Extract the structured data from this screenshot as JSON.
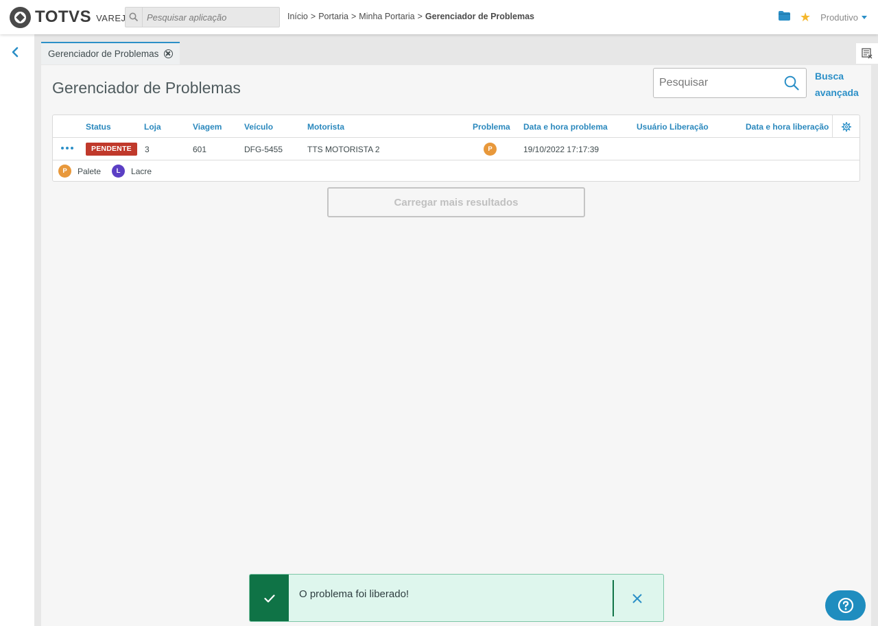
{
  "brand": {
    "name": "TOTVS",
    "product": "VAREJO"
  },
  "app_search": {
    "placeholder": "Pesquisar aplicação"
  },
  "breadcrumb": {
    "items": [
      "Início",
      "Portaria",
      "Minha Portaria"
    ],
    "current": "Gerenciador de Problemas",
    "separator": ">"
  },
  "header": {
    "user_menu": "Produtivo"
  },
  "tabs": [
    {
      "label": "Gerenciador de Problemas"
    }
  ],
  "page": {
    "title": "Gerenciador de Problemas",
    "search_placeholder": "Pesquisar",
    "advanced_search": "Busca avançada"
  },
  "table": {
    "columns": [
      "Status",
      "Loja",
      "Viagem",
      "Veículo",
      "Motorista",
      "Problema",
      "Data e hora problema",
      "Usuário Liberação",
      "Data e hora liberação"
    ],
    "rows": [
      {
        "status": "PENDENTE",
        "loja": "3",
        "viagem": "601",
        "veiculo": "DFG-5455",
        "motorista": "TTS MOTORISTA 2",
        "problema": "P",
        "data_hora_problema": "19/10/2022 17:17:39",
        "usuario_liberacao": "",
        "data_hora_liberacao": ""
      }
    ],
    "legend": [
      {
        "letter": "P",
        "label": "Palete",
        "color": "#e8983b"
      },
      {
        "letter": "L",
        "label": "Lacre",
        "color": "#5b3fc4"
      }
    ],
    "load_more": "Carregar mais resultados"
  },
  "toast": {
    "message": "O problema foi liberado!",
    "type": "success"
  },
  "colors": {
    "accent": "#2b8fc7",
    "status_pending": "#c0392b",
    "success": "#0f7346"
  }
}
